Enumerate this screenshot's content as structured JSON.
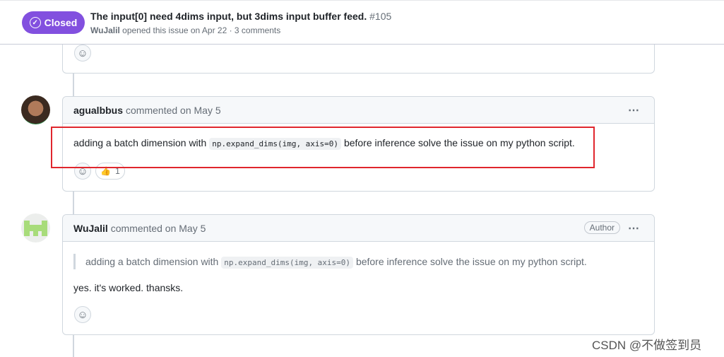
{
  "issue": {
    "status": "Closed",
    "title": "The input[0] need 4dims input, but 3dims input buffer feed.",
    "number": "#105",
    "author": "WuJalil",
    "meta": "opened this issue on Apr 22 · 3 comments"
  },
  "comments": [
    {
      "author": "agualbbus",
      "meta": "commented on May 5",
      "text_before": "adding a batch dimension with",
      "code": "np.expand_dims(img, axis=0)",
      "text_after": "before inference solve the issue on my python script.",
      "reaction_emoji": "👍",
      "reaction_count": "1"
    },
    {
      "author": "WuJalil",
      "meta": "commented on May 5",
      "badge": "Author",
      "quote_before": "adding a batch dimension with",
      "quote_code": "np.expand_dims(img, axis=0)",
      "quote_after": "before inference solve the issue on my python script.",
      "text": "yes. it's worked. thansks."
    }
  ],
  "icons": {
    "more": "⋯",
    "smiley": "☺",
    "check": "✓"
  },
  "watermark": "CSDN @不做签到员",
  "colors": {
    "closed": "#8250df",
    "highlight": "#e0262d"
  }
}
